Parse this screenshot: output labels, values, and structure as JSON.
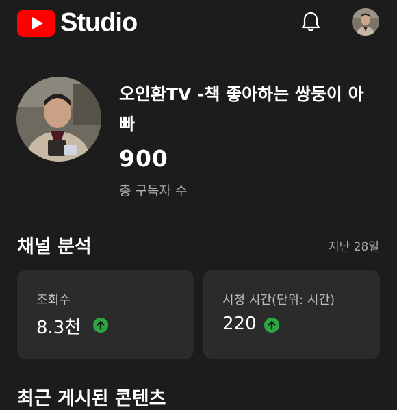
{
  "header": {
    "brand_label": "Studio",
    "logo_icon": "youtube-play-icon",
    "notification_icon": "bell-icon",
    "account_icon": "account-avatar",
    "brand_color": "#ff0000"
  },
  "channel": {
    "name": "오인환TV -책 좋아하는 쌍둥이 아빠",
    "subscribers": "900",
    "subscribers_label": "총 구독자 수"
  },
  "analytics": {
    "title": "채널 분석",
    "period": "지난 28일",
    "cards": [
      {
        "label": "조회수",
        "value": "8.3천",
        "trend": "up",
        "trend_icon": "arrow-up-circle-icon"
      },
      {
        "label": "시청 시간(단위: 시간)",
        "value": "220",
        "trend": "up",
        "trend_icon": "arrow-up-circle-icon"
      }
    ],
    "trend_color": "#2ba640"
  },
  "next_section": {
    "title": "최근 게시된 콘텐츠"
  }
}
